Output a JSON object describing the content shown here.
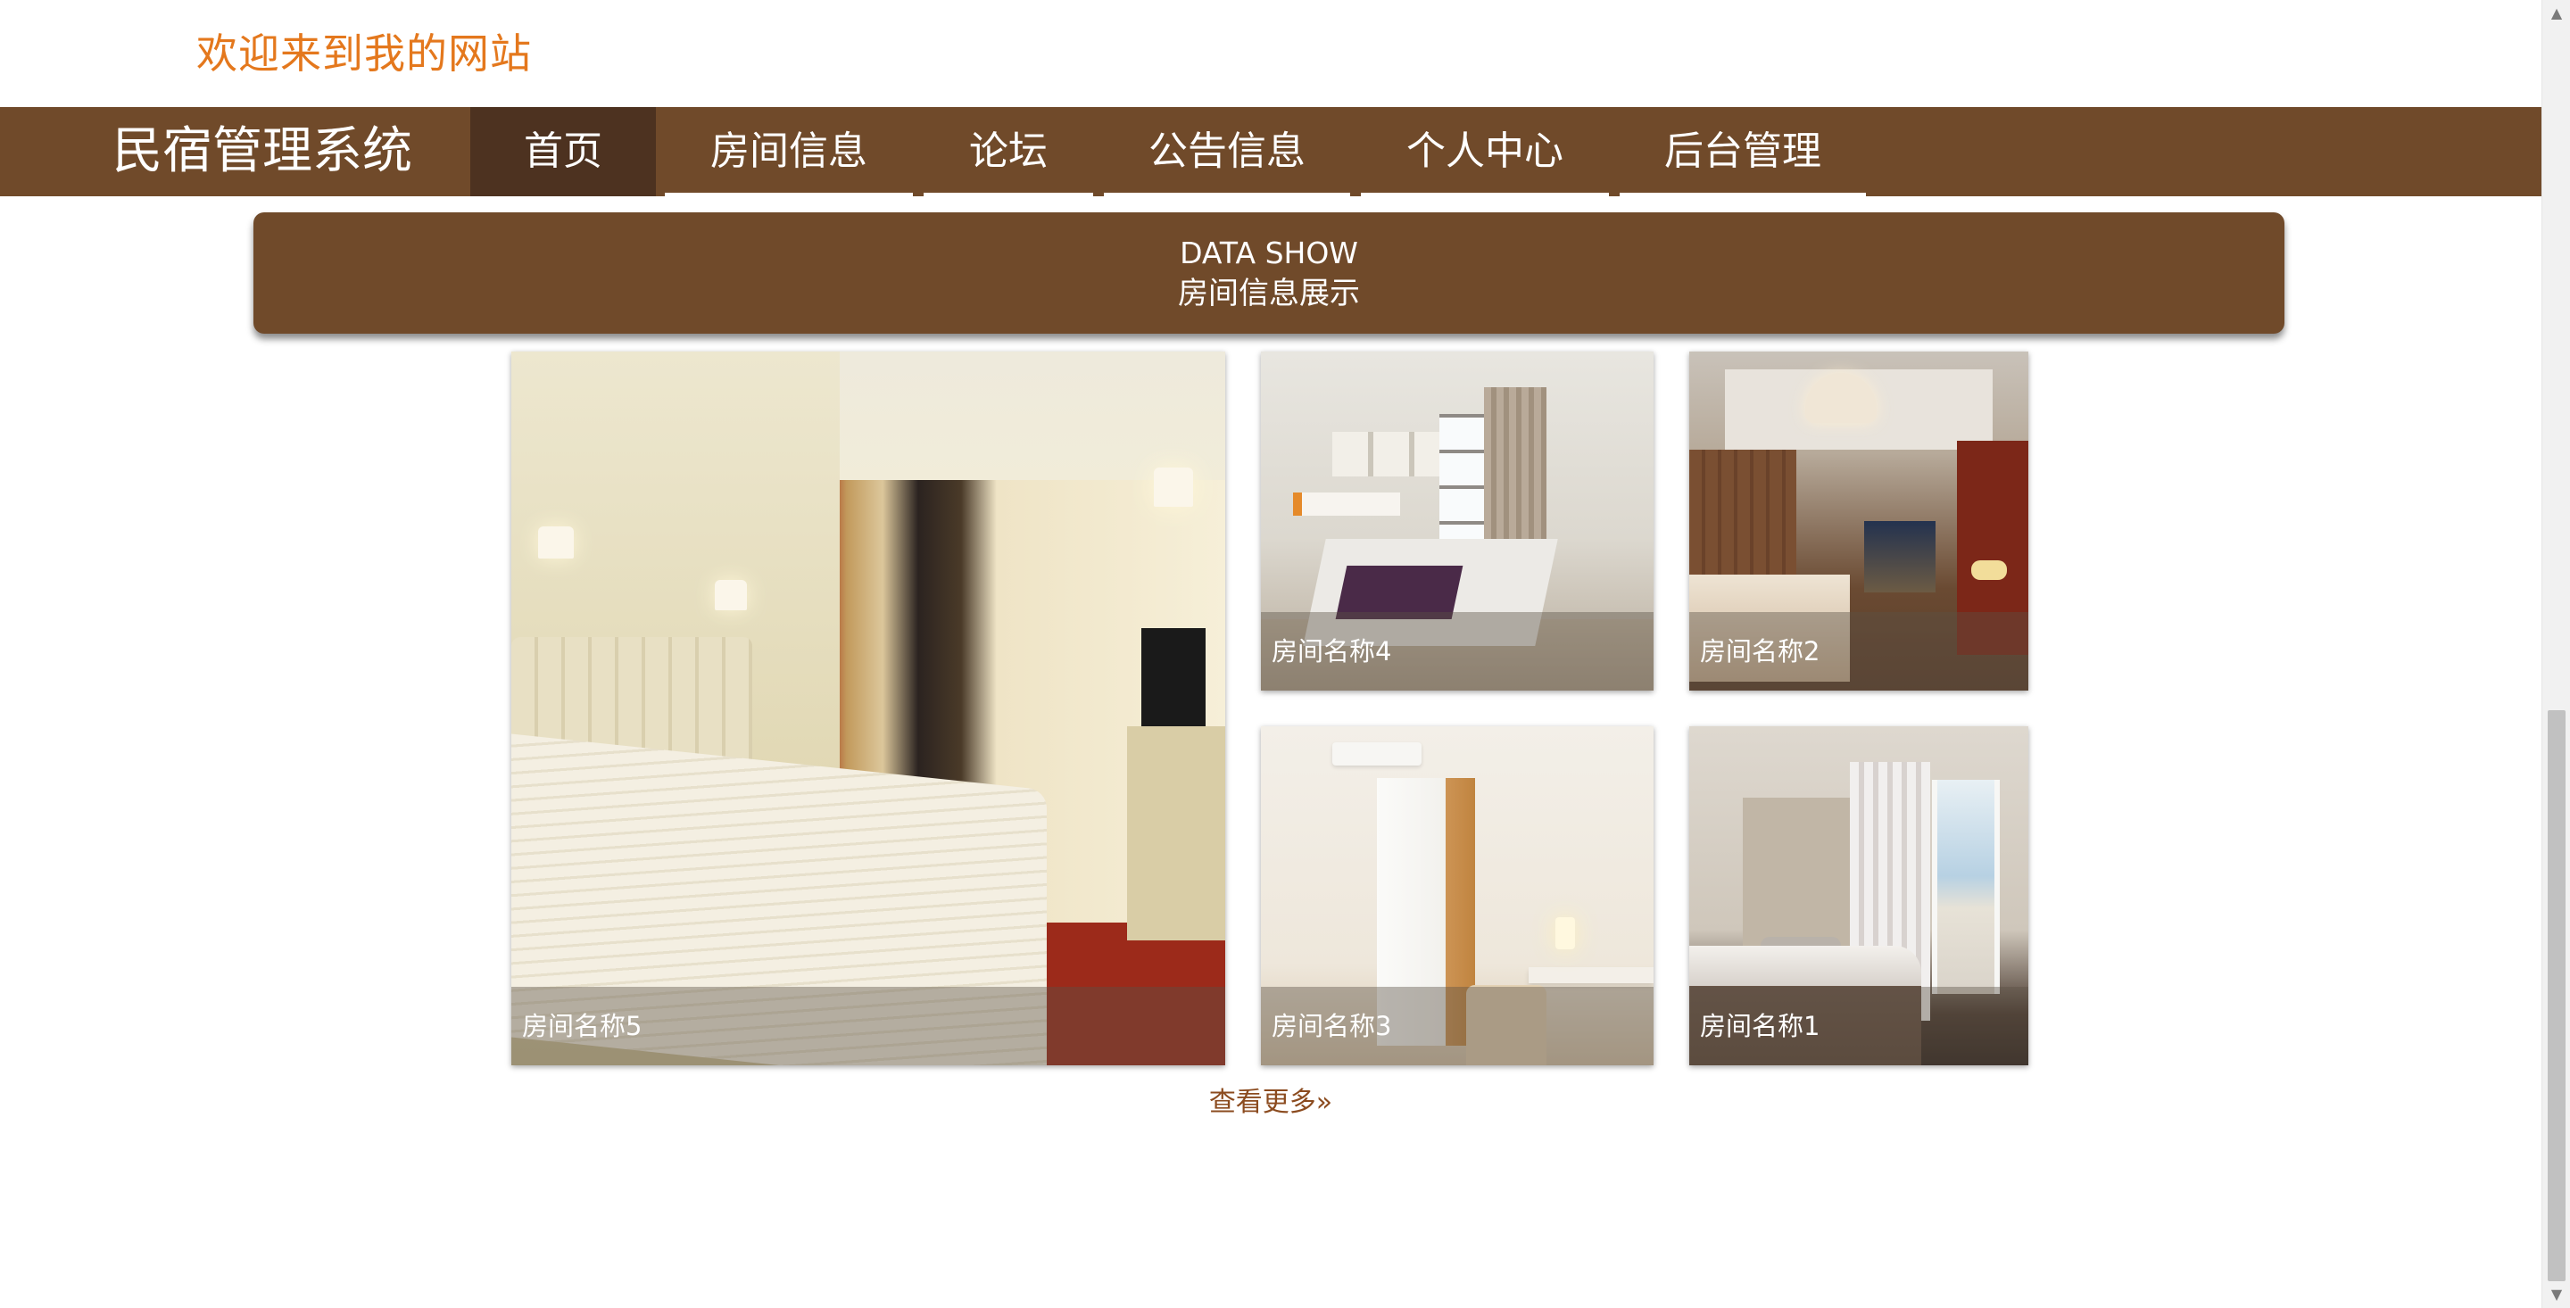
{
  "header": {
    "welcome_text": "欢迎来到我的网站"
  },
  "nav": {
    "brand": "民宿管理系统",
    "items": [
      {
        "label": "首页",
        "active": true
      },
      {
        "label": "房间信息",
        "active": false
      },
      {
        "label": "论坛",
        "active": false
      },
      {
        "label": "公告信息",
        "active": false
      },
      {
        "label": "个人中心",
        "active": false
      },
      {
        "label": "后台管理",
        "active": false
      }
    ]
  },
  "section": {
    "title_en": "DATA SHOW",
    "title_cn": "房间信息展示"
  },
  "rooms": [
    {
      "name": "房间名称5"
    },
    {
      "name": "房间名称4"
    },
    {
      "name": "房间名称2"
    },
    {
      "name": "房间名称3"
    },
    {
      "name": "房间名称1"
    }
  ],
  "more_link": "查看更多»",
  "colors": {
    "brand_brown": "#704a2a",
    "active_nav": "#4d3220",
    "welcome_orange": "#e4781d",
    "link_brown": "#8b4b1f"
  }
}
